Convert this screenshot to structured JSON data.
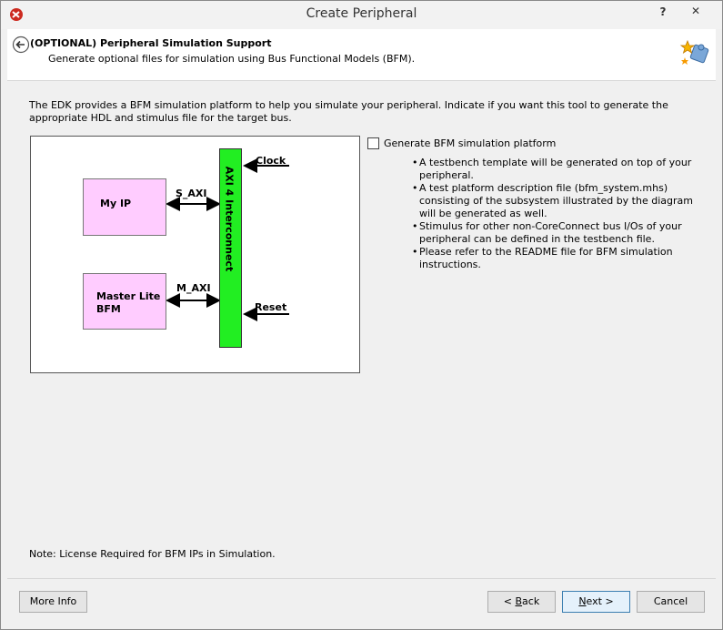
{
  "window": {
    "title": "Create Peripheral",
    "help_glyph": "?",
    "close_glyph": "✕"
  },
  "header": {
    "title": "(OPTIONAL) Peripheral Simulation Support",
    "subtitle": "Generate optional files for simulation using Bus Functional Models (BFM)."
  },
  "content": {
    "intro": "The EDK provides a BFM simulation platform to help you simulate your peripheral. Indicate if you want this tool to generate the appropriate HDL and stimulus file for the target bus.",
    "diagram": {
      "box1": "My IP",
      "box2_line1": "Master Lite",
      "box2_line2": "BFM",
      "bus": "AXI 4 Interconnect",
      "sig_s_axi": "S_AXI",
      "sig_m_axi": "M_AXI",
      "sig_clock": "Clock",
      "sig_reset": "Reset"
    },
    "checkbox_label": "Generate BFM simulation platform",
    "checkbox_checked": false,
    "bullets": [
      "A testbench template will be generated on top of your peripheral.",
      "A test platform description file (bfm_system.mhs) consisting of the subsystem illustrated by the diagram will be generated as well.",
      "Stimulus for other non-CoreConnect bus I/Os of your peripheral can be defined in the testbench file.",
      "Please refer to the README file for BFM simulation instructions."
    ],
    "note": "Note: License Required for BFM IPs in Simulation."
  },
  "footer": {
    "more_info": "More Info",
    "back_prefix": "< ",
    "back_key": "B",
    "back_rest": "ack",
    "next_prefix": "",
    "next_key": "N",
    "next_rest": "ext >",
    "cancel": "Cancel"
  }
}
